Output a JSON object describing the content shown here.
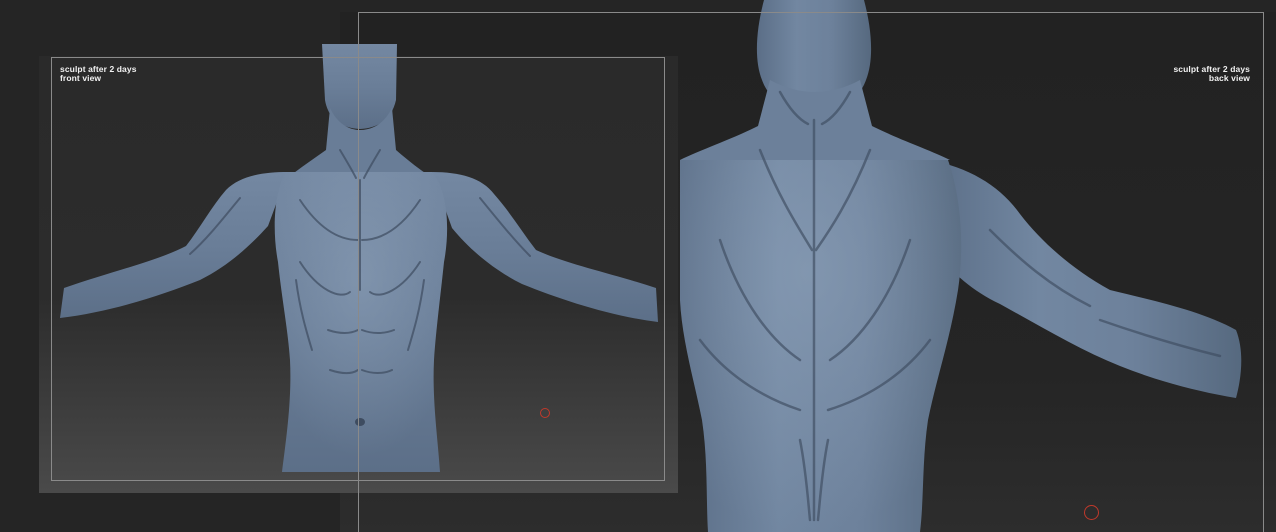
{
  "front_view": {
    "caption_line1": "sculpt after 2 days",
    "caption_line2": "front view"
  },
  "back_view": {
    "caption_line1": "sculpt after 2 days",
    "caption_line2": "back view"
  },
  "colors": {
    "sculpt_base": "#6b7f99",
    "sculpt_shadow": "#3e4c60",
    "sculpt_highlight": "#8ea2ba",
    "frame_border": "#8a8a8a",
    "marker": "#c0392b",
    "caption_text": "#f2f2f2"
  }
}
